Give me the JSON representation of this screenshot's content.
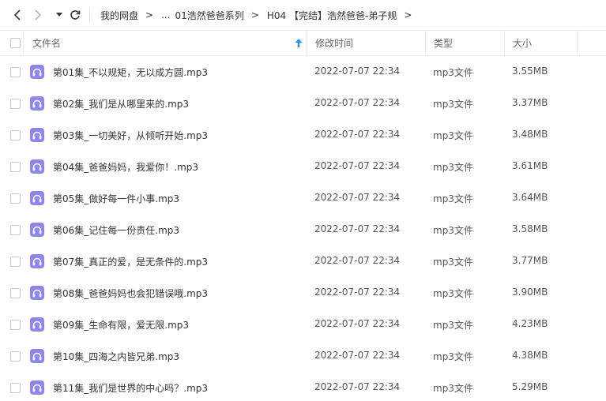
{
  "nav": {
    "back_icon": "chevron-left-icon",
    "forward_icon": "chevron-right-icon",
    "dropdown_icon": "caret-down-icon",
    "refresh_icon": "refresh-icon"
  },
  "breadcrumb": {
    "root": "我的网盘",
    "separator": ">",
    "ellipsis": "...",
    "items": [
      "01浩然爸爸系列",
      "H04 【完结】浩然爸爸-弟子规"
    ]
  },
  "columns": {
    "name": "文件名",
    "modified": "修改时间",
    "type": "类型",
    "size": "大小"
  },
  "sort": {
    "column": "name",
    "direction": "ascending",
    "icon": "sort-up-arrow-icon"
  },
  "colors": {
    "accent": "#2196f3",
    "audio_icon_bg": "#8f85f5"
  },
  "files": [
    {
      "name": "第01集_不以规矩，无以成方圆.mp3",
      "modified": "2022-07-07 22:34",
      "type": "mp3文件",
      "size": "3.55MB",
      "icon": "audio-file-icon"
    },
    {
      "name": "第02集_我们是从哪里来的.mp3",
      "modified": "2022-07-07 22:34",
      "type": "mp3文件",
      "size": "3.37MB",
      "icon": "audio-file-icon"
    },
    {
      "name": "第03集_一切美好，从倾听开始.mp3",
      "modified": "2022-07-07 22:34",
      "type": "mp3文件",
      "size": "3.48MB",
      "icon": "audio-file-icon"
    },
    {
      "name": "第04集_爸爸妈妈，我爱你！.mp3",
      "modified": "2022-07-07 22:34",
      "type": "mp3文件",
      "size": "3.61MB",
      "icon": "audio-file-icon"
    },
    {
      "name": "第05集_做好每一件小事.mp3",
      "modified": "2022-07-07 22:34",
      "type": "mp3文件",
      "size": "3.64MB",
      "icon": "audio-file-icon"
    },
    {
      "name": "第06集_记住每一份责任.mp3",
      "modified": "2022-07-07 22:34",
      "type": "mp3文件",
      "size": "3.58MB",
      "icon": "audio-file-icon"
    },
    {
      "name": "第07集_真正的爱，是无条件的.mp3",
      "modified": "2022-07-07 22:34",
      "type": "mp3文件",
      "size": "3.77MB",
      "icon": "audio-file-icon"
    },
    {
      "name": "第08集_爸爸妈妈也会犯错误哦.mp3",
      "modified": "2022-07-07 22:34",
      "type": "mp3文件",
      "size": "3.90MB",
      "icon": "audio-file-icon"
    },
    {
      "name": "第09集_生命有限，爱无限.mp3",
      "modified": "2022-07-07 22:34",
      "type": "mp3文件",
      "size": "4.23MB",
      "icon": "audio-file-icon"
    },
    {
      "name": "第10集_四海之内皆兄弟.mp3",
      "modified": "2022-07-07 22:34",
      "type": "mp3文件",
      "size": "4.38MB",
      "icon": "audio-file-icon"
    },
    {
      "name": "第11集_我们是世界的中心吗？.mp3",
      "modified": "2022-07-07 22:34",
      "type": "mp3文件",
      "size": "5.29MB",
      "icon": "audio-file-icon"
    }
  ]
}
